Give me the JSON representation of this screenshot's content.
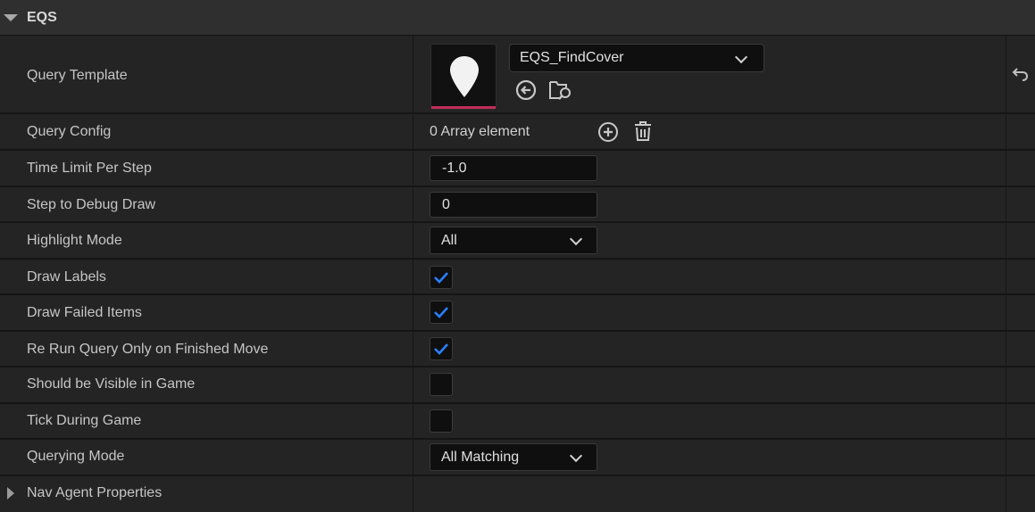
{
  "section": {
    "title": "EQS"
  },
  "query_template": {
    "label": "Query Template",
    "asset_name": "EQS_FindCover",
    "accent_color": "#c22c5a",
    "icons": [
      "location-pin-icon",
      "use-selected-icon",
      "browse-asset-icon",
      "reset-to-default-icon"
    ]
  },
  "query_config": {
    "label": "Query Config",
    "value": "0 Array element"
  },
  "time_limit": {
    "label": "Time Limit Per Step",
    "value": "-1.0"
  },
  "step_debug": {
    "label": "Step to Debug Draw",
    "value": "0"
  },
  "highlight_mode": {
    "label": "Highlight Mode",
    "value": "All"
  },
  "draw_labels": {
    "label": "Draw Labels",
    "checked": true
  },
  "draw_failed": {
    "label": "Draw Failed Items",
    "checked": true
  },
  "rerun_query": {
    "label": "Re Run Query Only on Finished Move",
    "checked": true
  },
  "visible_in_game": {
    "label": "Should be Visible in Game",
    "checked": false
  },
  "tick_during_game": {
    "label": "Tick During Game",
    "checked": false
  },
  "querying_mode": {
    "label": "Querying Mode",
    "value": "All Matching"
  },
  "nav_agent": {
    "label": "Nav Agent Properties"
  },
  "colors": {
    "check": "#2a7fff",
    "background": "#242424",
    "field": "#0f0f0f"
  }
}
